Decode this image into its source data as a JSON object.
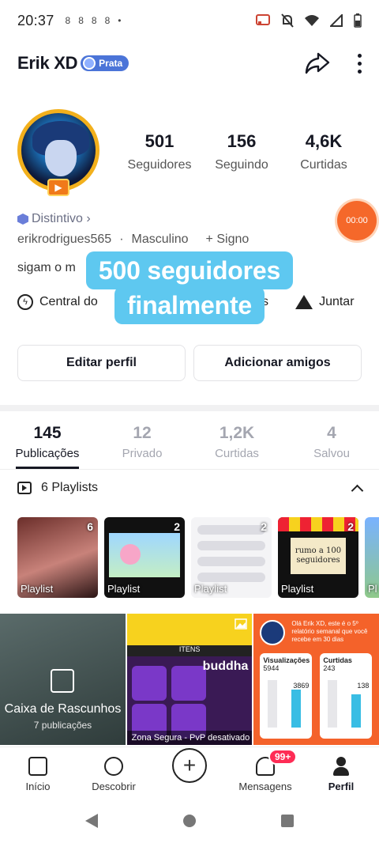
{
  "status_bar": {
    "time": "20:37",
    "notif_icons": [
      "8",
      "8",
      "8",
      "8",
      "•"
    ]
  },
  "header": {
    "username": "Erik XD",
    "badge": "Prata"
  },
  "profile": {
    "stats": [
      {
        "value": "501",
        "label": "Seguidores"
      },
      {
        "value": "156",
        "label": "Seguindo"
      },
      {
        "value": "4,6K",
        "label": "Curtidas"
      }
    ],
    "distintivo": "Distintivo ›",
    "handle": "erikrodrigues565",
    "gender": "Masculino",
    "sign": "+ Signo",
    "bio": "sigam o m",
    "timer": "00:00",
    "links": [
      {
        "label": "Central do",
        "icon": "lightning-icon"
      },
      {
        "label": "ras",
        "icon": "none"
      },
      {
        "label": "Juntar",
        "icon": "tent-icon"
      }
    ]
  },
  "caption": {
    "line1": "500 seguidores",
    "line2": "finalmente"
  },
  "buttons": {
    "edit": "Editar perfil",
    "add_friends": "Adicionar amigos"
  },
  "tabs": [
    {
      "value": "145",
      "label": "Publicações",
      "active": true
    },
    {
      "value": "12",
      "label": "Privado"
    },
    {
      "value": "1,2K",
      "label": "Curtidas"
    },
    {
      "value": "4",
      "label": "Salvou"
    }
  ],
  "playlists": {
    "header": "6 Playlists",
    "items": [
      {
        "count": "6",
        "label": "Playlist"
      },
      {
        "count": "2",
        "label": "Playlist"
      },
      {
        "count": "2",
        "label": "Playlist"
      },
      {
        "count": "2",
        "label": "Playlist",
        "paper_text": "rumo a 100 seguidores"
      },
      {
        "count": "",
        "label": "Pl"
      }
    ]
  },
  "posts": {
    "drafts_title": "Caixa de Rascunhos",
    "drafts_sub": "7 publicações",
    "game_banner": "ITENS",
    "game_word": "buddha",
    "game_zone": "Zona Segura - PvP desativado",
    "report_head": "Olá Erik XD, este é o 5º relatório semanal que você recebe em 30 dias",
    "report_cards": [
      {
        "title": "Visualizações",
        "value": "5944",
        "delta": "3869"
      },
      {
        "title": "Curtidas",
        "value": "243",
        "delta": "138"
      }
    ]
  },
  "bottom_nav": [
    {
      "label": "Início",
      "icon": "home-icon"
    },
    {
      "label": "Descobrir",
      "icon": "compass-icon"
    },
    {
      "label": "",
      "icon": "plus-icon"
    },
    {
      "label": "Mensagens",
      "icon": "bell-icon",
      "badge": "99+"
    },
    {
      "label": "Perfil",
      "icon": "user-icon",
      "active": true
    }
  ],
  "colors": {
    "caption_bg": "#5ec8f0",
    "timer_bg": "#f5682a",
    "badge_red": "#fe2c55",
    "prata_badge": "#4b74d8"
  }
}
